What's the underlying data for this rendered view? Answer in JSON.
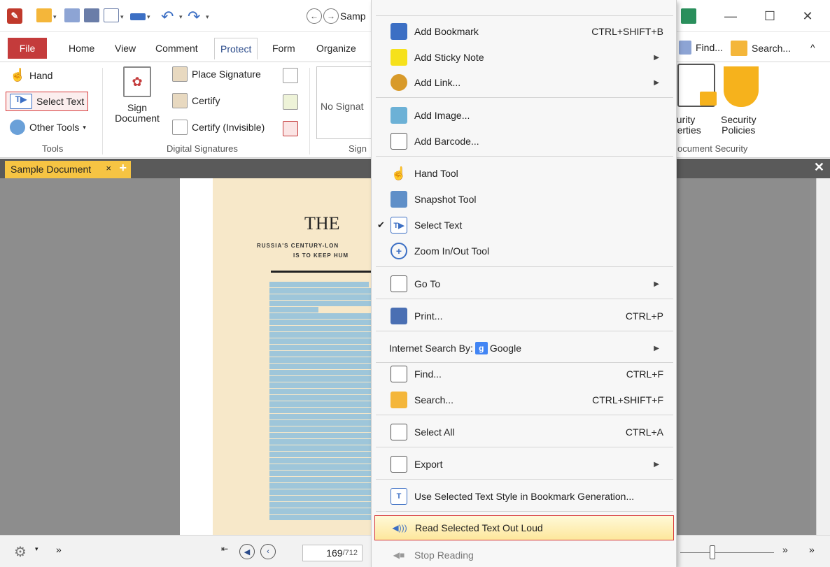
{
  "window": {
    "title": "Samp",
    "min_glyph": "—",
    "max_glyph": "☐",
    "close_glyph": "✕"
  },
  "ribbon_tabs": [
    "File",
    "Home",
    "View",
    "Comment",
    "Protect",
    "Form",
    "Organize"
  ],
  "ribbon_right": {
    "find": "Find...",
    "search": "Search...",
    "collapse": "^"
  },
  "tools": {
    "hand": "Hand",
    "select_text": "Select Text",
    "other_tools": "Other Tools",
    "group_label": "Tools"
  },
  "digital_signatures": {
    "sign_document_1": "Sign",
    "sign_document_2": "Document",
    "place_signature": "Place Signature",
    "certify": "Certify",
    "certify_invisible": "Certify (Invisible)",
    "group_label": "Digital Signatures",
    "no_signature": "No Signat",
    "partial_group_label": "Sign"
  },
  "document_security": {
    "security_properties_1": "ecurity",
    "security_properties_2": "operties",
    "security_policies_1": "Security",
    "security_policies_2": "Policies",
    "group_label": "ocument Security"
  },
  "document_tab": {
    "label": "Sample Document",
    "close": "×",
    "add": "+"
  },
  "document": {
    "title": "THE",
    "subtitle_1": "RUSSIA'S CENTURY-LON",
    "subtitle_2": "IS TO KEEP HUM"
  },
  "statusbar": {
    "page_current": "169",
    "page_total": "/712"
  },
  "menu": {
    "add_bookmark": {
      "label": "Add Bookmark",
      "shortcut": "CTRL+SHIFT+B"
    },
    "add_sticky_note": {
      "label": "Add Sticky Note"
    },
    "add_link": {
      "label": "Add Link..."
    },
    "add_image": {
      "label": "Add Image..."
    },
    "add_barcode": {
      "label": "Add Barcode..."
    },
    "hand_tool": {
      "label": "Hand Tool"
    },
    "snapshot_tool": {
      "label": "Snapshot Tool"
    },
    "select_text": {
      "label": "Select Text",
      "checked": "✔"
    },
    "zoom_tool": {
      "label": "Zoom In/Out Tool"
    },
    "go_to": {
      "label": "Go To"
    },
    "print": {
      "label": "Print...",
      "shortcut": "CTRL+P"
    },
    "internet_search": {
      "label": "Internet Search By:",
      "engine": "Google",
      "engine_icon": "g"
    },
    "find": {
      "label": "Find...",
      "shortcut": "CTRL+F"
    },
    "search": {
      "label": "Search...",
      "shortcut": "CTRL+SHIFT+F"
    },
    "select_all": {
      "label": "Select All",
      "shortcut": "CTRL+A"
    },
    "export": {
      "label": "Export"
    },
    "bookmark_style": {
      "label": "Use Selected Text Style in Bookmark Generation..."
    },
    "read_aloud": {
      "label": "Read Selected Text Out Loud"
    },
    "stop_reading": {
      "label": "Stop Reading"
    }
  },
  "colors": {
    "accent_red": "#c43b3b",
    "document_tab": "#f6c443",
    "highlight_border": "#d83a3a",
    "selection_blue": "#9ec6da"
  }
}
